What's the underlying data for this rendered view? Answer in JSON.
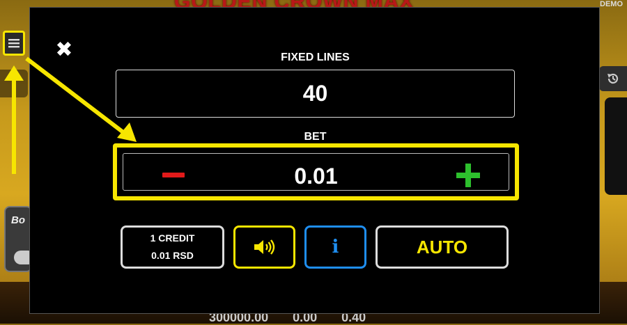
{
  "background": {
    "game_title": "GOLDEN CROWN MAX",
    "demo_badge": "DEMO",
    "bonus_label": "Bo",
    "bottom_values": "300000.00 0.00 0.40"
  },
  "icons": {
    "menu": "menu-icon",
    "close": "close-icon",
    "history": "history-icon",
    "sound": "speaker-icon",
    "info": "info-icon"
  },
  "modal": {
    "close_symbol": "✖",
    "fixed_lines_label": "FIXED LINES",
    "fixed_lines_value": "40",
    "bet_label": "BET",
    "bet_value": "0.01",
    "credit_line1": "1 CREDIT",
    "credit_line2": "0.01 RSD",
    "info_symbol": "i",
    "auto_label": "AUTO"
  },
  "colors": {
    "highlight": "#f7e600",
    "minus": "#e21a1a",
    "plus": "#2dc02d",
    "info": "#1f8ef0"
  }
}
